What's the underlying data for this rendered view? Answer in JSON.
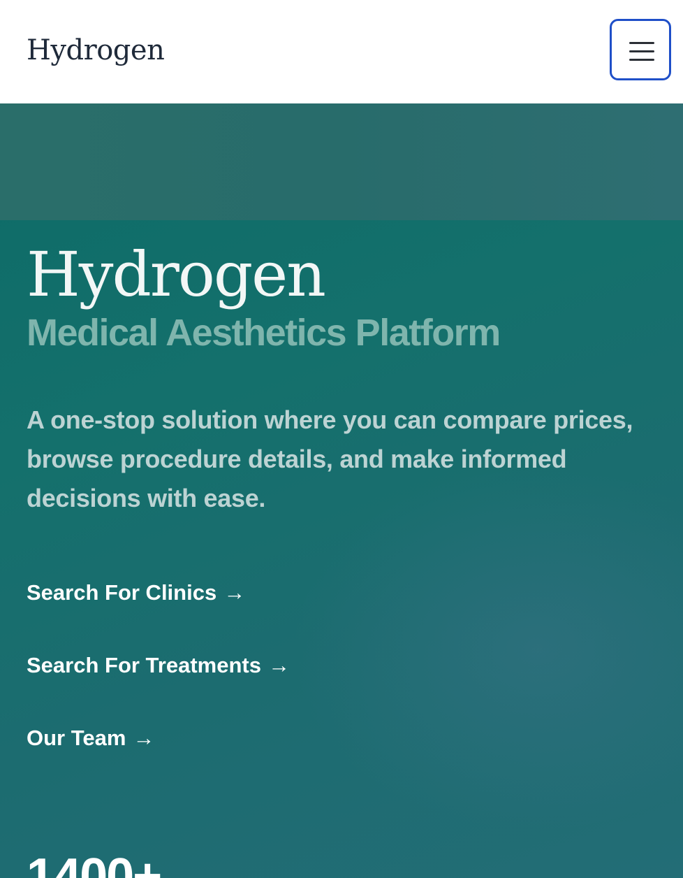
{
  "header": {
    "brand": "Hydrogen",
    "menu_icon": "hamburger-menu-icon"
  },
  "hero": {
    "title": "Hydrogen",
    "subtitle": "Medical Aesthetics Platform",
    "description": "A one-stop solution where you can compare prices, browse procedure details, and make informed decisions with ease.",
    "links": [
      {
        "label": "Search For Clinics",
        "arrow": "→"
      },
      {
        "label": "Search For Treatments",
        "arrow": "→"
      },
      {
        "label": "Our Team",
        "arrow": "→"
      }
    ],
    "stat": "1400+"
  },
  "colors": {
    "hero_background": "#14706c",
    "subtitle": "#7fb5ad",
    "menu_border": "#1f4fc8"
  }
}
